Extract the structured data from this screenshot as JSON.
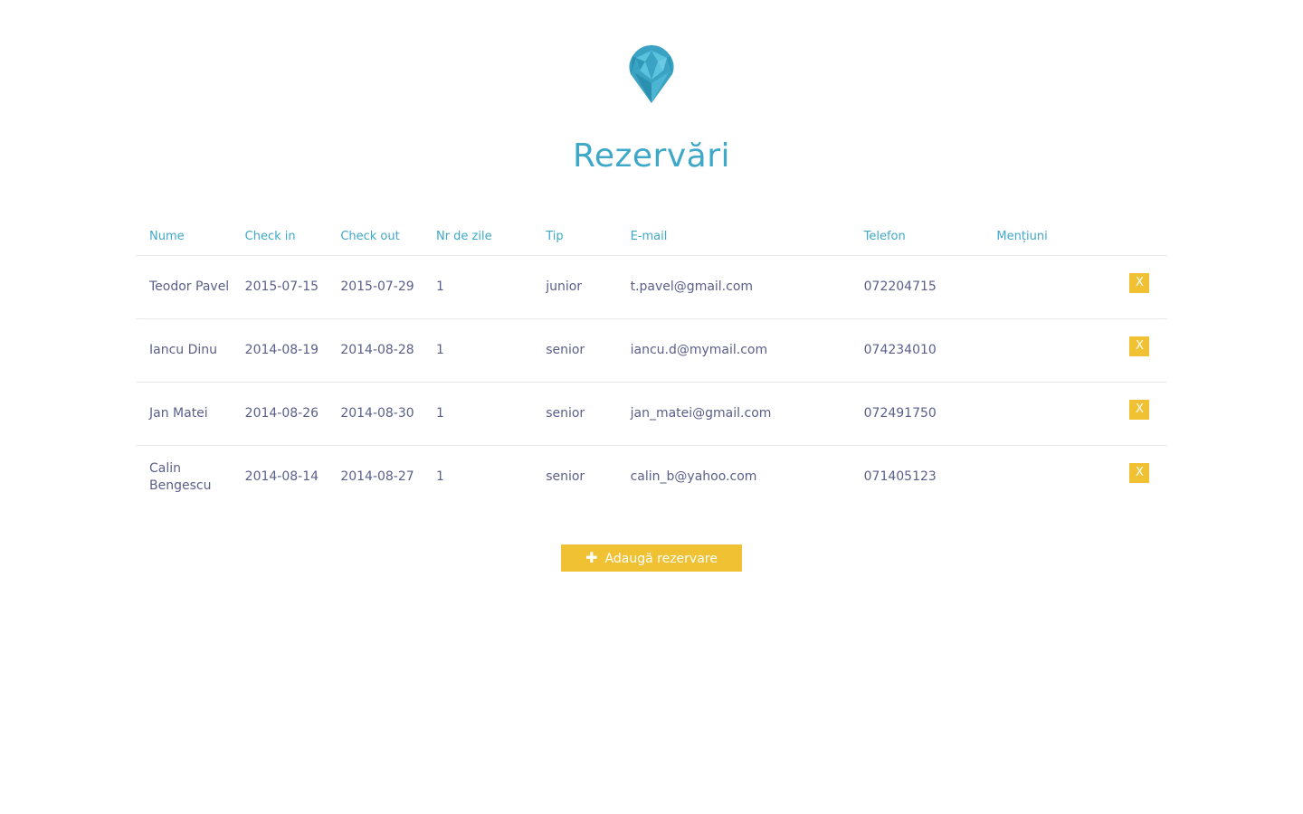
{
  "title": "Rezervări",
  "colors": {
    "accent": "#3ea8c9",
    "button": "#f0c133",
    "text": "#5a5f8a",
    "gem": "#3aa3c4"
  },
  "logo": {
    "icon": "gem-icon"
  },
  "table": {
    "headers": {
      "name": "Nume",
      "check_in": "Check in",
      "check_out": "Check out",
      "days": "Nr de zile",
      "type": "Tip",
      "email": "E-mail",
      "phone": "Telefon",
      "notes": "Mențiuni"
    },
    "rows": [
      {
        "name": "Teodor Pavel",
        "check_in": "2015-07-15",
        "check_out": "2015-07-29",
        "days": "1",
        "type": "junior",
        "email": "t.pavel@gmail.com",
        "phone": "072204715",
        "notes": "",
        "delete_label": "X"
      },
      {
        "name": "Iancu Dinu",
        "check_in": "2014-08-19",
        "check_out": "2014-08-28",
        "days": "1",
        "type": "senior",
        "email": "iancu.d@mymail.com",
        "phone": "074234010",
        "notes": "",
        "delete_label": "X"
      },
      {
        "name": "Jan Matei",
        "check_in": "2014-08-26",
        "check_out": "2014-08-30",
        "days": "1",
        "type": "senior",
        "email": "jan_matei@gmail.com",
        "phone": "072491750",
        "notes": "",
        "delete_label": "X"
      },
      {
        "name": "Calin Bengescu",
        "check_in": "2014-08-14",
        "check_out": "2014-08-27",
        "days": "1",
        "type": "senior",
        "email": "calin_b@yahoo.com",
        "phone": "071405123",
        "notes": "",
        "delete_label": "X"
      }
    ]
  },
  "add_button": {
    "icon": "plus-icon",
    "label": "Adaugă rezervare"
  }
}
